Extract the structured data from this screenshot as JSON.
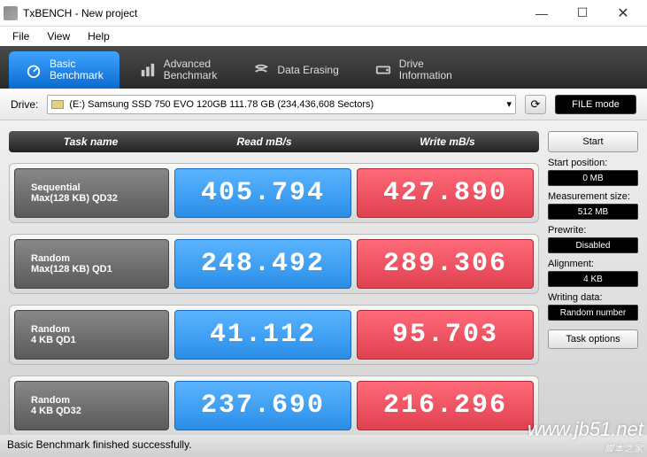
{
  "window": {
    "title": "TxBENCH - New project"
  },
  "menu": {
    "file": "File",
    "view": "View",
    "help": "Help"
  },
  "tabs": {
    "basic": "Basic\nBenchmark",
    "advanced": "Advanced\nBenchmark",
    "erasing": "Data Erasing",
    "driveinfo": "Drive\nInformation"
  },
  "drive": {
    "label": "Drive:",
    "selected": "(E:) Samsung SSD 750 EVO 120GB  111.78 GB (234,436,608 Sectors)",
    "filemode": "FILE mode"
  },
  "headers": {
    "task": "Task name",
    "read": "Read mB/s",
    "write": "Write mB/s"
  },
  "rows": [
    {
      "name1": "Sequential",
      "name2": "Max(128 KB) QD32",
      "read": "405.794",
      "write": "427.890"
    },
    {
      "name1": "Random",
      "name2": "Max(128 KB) QD1",
      "read": "248.492",
      "write": "289.306"
    },
    {
      "name1": "Random",
      "name2": "4 KB QD1",
      "read": "41.112",
      "write": "95.703"
    },
    {
      "name1": "Random",
      "name2": "4 KB QD32",
      "read": "237.690",
      "write": "216.296"
    }
  ],
  "side": {
    "start": "Start",
    "startpos_lbl": "Start position:",
    "startpos_val": "0 MB",
    "measure_lbl": "Measurement size:",
    "measure_val": "512 MB",
    "prewrite_lbl": "Prewrite:",
    "prewrite_val": "Disabled",
    "align_lbl": "Alignment:",
    "align_val": "4 KB",
    "writing_lbl": "Writing data:",
    "writing_val": "Random number",
    "taskopt": "Task options"
  },
  "status": "Basic Benchmark finished successfully.",
  "watermark": {
    "line1": "www.jb51.net",
    "line2": "脚本之家"
  }
}
